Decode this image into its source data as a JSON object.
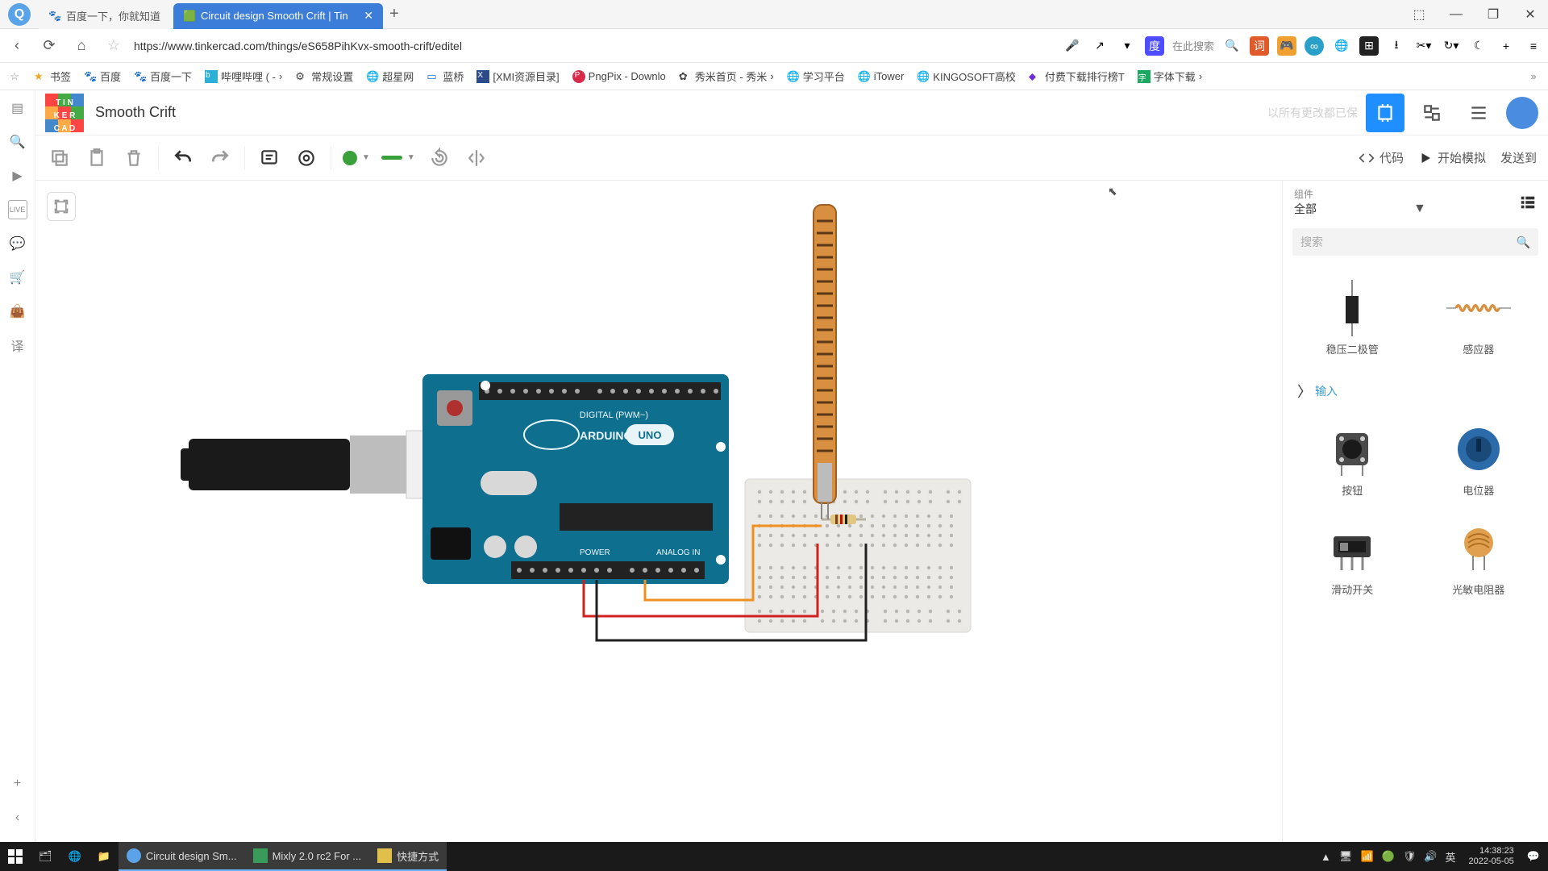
{
  "browser": {
    "tabs": [
      {
        "title": "百度一下，你就知道",
        "active": false
      },
      {
        "title": "Circuit design Smooth Crift | Tin",
        "active": true
      }
    ],
    "url": "https://www.tinkercad.com/things/eS658PihKvx-smooth-crift/editel",
    "search_hint": "在此搜索"
  },
  "bookmarks": [
    "书签",
    "百度",
    "百度一下",
    "哔哩哔哩 ( -",
    "常规设置",
    "超星网",
    "蓝桥",
    "[XMI资源目录]",
    "PngPix - Downlo",
    "秀米首页 - 秀米",
    "学习平台",
    "iTower",
    "KINGOSOFT高校",
    "付费下载排行榜T",
    "字体下载"
  ],
  "tinkercad": {
    "project_title": "Smooth Crift",
    "header_faded": "以所有更改都已保",
    "toolbar_right": {
      "code": "代码",
      "simulate": "开始模拟",
      "send": "发送到"
    },
    "panel": {
      "label": "组件",
      "selected": "全部",
      "search_ph": "搜索",
      "section": "输入"
    },
    "components": [
      {
        "name": "稳压二极管"
      },
      {
        "name": "感应器"
      },
      {
        "name": "按钮"
      },
      {
        "name": "电位器"
      },
      {
        "name": "滑动开关"
      },
      {
        "name": "光敏电阻器"
      }
    ]
  },
  "taskbar": {
    "apps": [
      {
        "label": "",
        "type": "start"
      },
      {
        "label": "",
        "type": "icon"
      },
      {
        "label": "",
        "type": "icon"
      },
      {
        "label": "",
        "type": "icon"
      },
      {
        "label": "Circuit design Sm...",
        "type": "app",
        "active": true
      },
      {
        "label": "Mixly 2.0 rc2 For ...",
        "type": "app"
      },
      {
        "label": "快捷方式",
        "type": "app"
      }
    ],
    "tray": {
      "ime": "英",
      "time": "14:38:23",
      "date": "2022-05-05"
    }
  }
}
